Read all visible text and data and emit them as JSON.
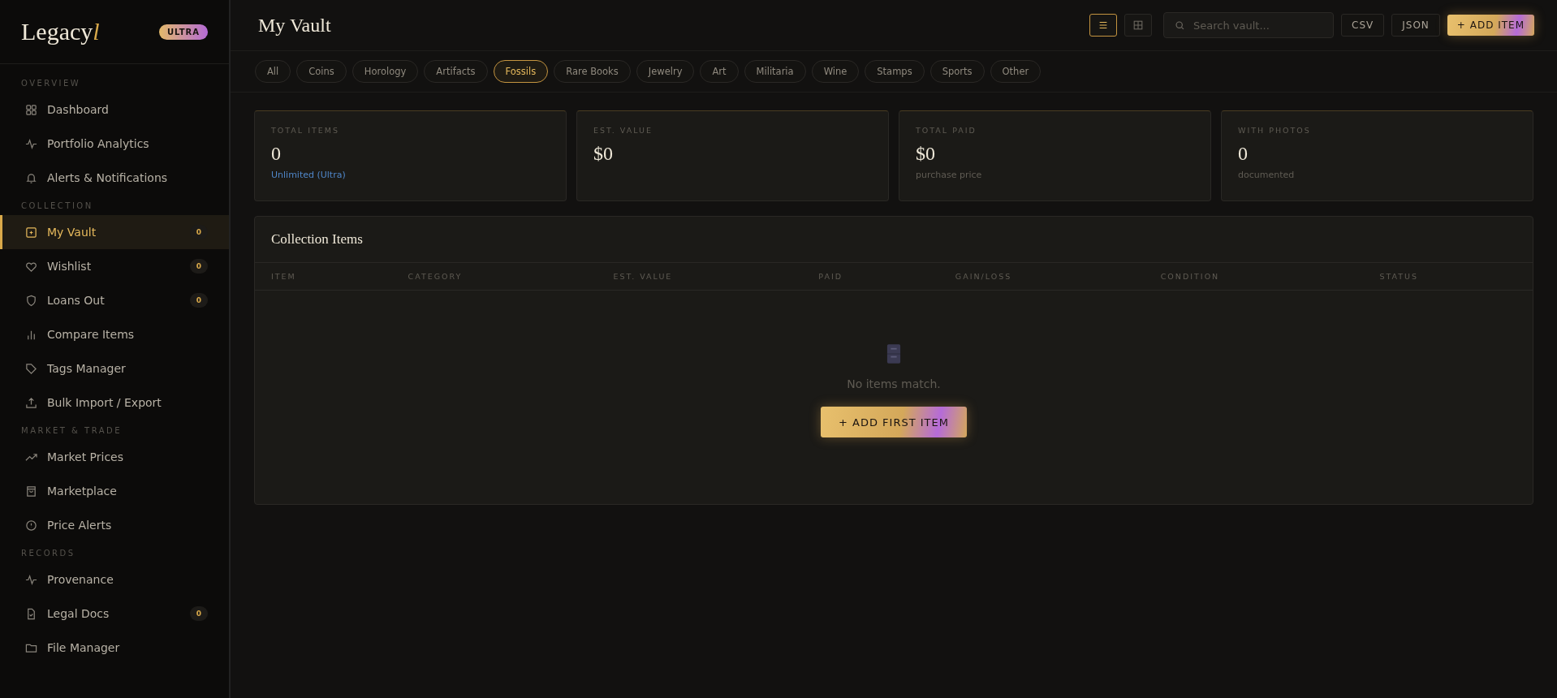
{
  "sidebar": {
    "logo": "Legacy",
    "logo_mark": "l",
    "plan_badge": "ULTRA",
    "sections": [
      {
        "title": "OVERVIEW",
        "items": [
          {
            "label": "Dashboard",
            "selected": false
          },
          {
            "label": "Portfolio Analytics",
            "selected": false
          },
          {
            "label": "Alerts & Notifications",
            "selected": false
          }
        ]
      },
      {
        "title": "COLLECTION",
        "items": [
          {
            "label": "My Vault",
            "selected": true,
            "count": "0"
          },
          {
            "label": "Wishlist",
            "selected": false,
            "count": "0"
          },
          {
            "label": "Loans Out",
            "selected": false,
            "count": "0"
          },
          {
            "label": "Compare Items",
            "selected": false
          },
          {
            "label": "Tags Manager",
            "selected": false
          },
          {
            "label": "Bulk Import / Export",
            "selected": false
          }
        ]
      },
      {
        "title": "MARKET & TRADE",
        "items": [
          {
            "label": "Market Prices",
            "selected": false
          },
          {
            "label": "Marketplace",
            "selected": false
          },
          {
            "label": "Price Alerts",
            "selected": false
          }
        ]
      },
      {
        "title": "RECORDS",
        "items": [
          {
            "label": "Provenance",
            "selected": false
          },
          {
            "label": "Legal Docs",
            "selected": false,
            "count": "0"
          },
          {
            "label": "File Manager",
            "selected": false
          }
        ]
      }
    ]
  },
  "header": {
    "title": "My Vault",
    "views": [
      {
        "kind": "list",
        "selected": true
      },
      {
        "kind": "grid",
        "selected": false
      }
    ],
    "search": {
      "placeholder": "Search vault..."
    },
    "export_buttons": [
      "CSV",
      "JSON"
    ],
    "add_button": "+ ADD ITEM"
  },
  "filters": [
    {
      "label": "All",
      "selected": false
    },
    {
      "label": "Coins",
      "selected": false
    },
    {
      "label": "Horology",
      "selected": false
    },
    {
      "label": "Artifacts",
      "selected": false
    },
    {
      "label": "Fossils",
      "selected": true
    },
    {
      "label": "Rare Books",
      "selected": false
    },
    {
      "label": "Jewelry",
      "selected": false
    },
    {
      "label": "Art",
      "selected": false
    },
    {
      "label": "Militaria",
      "selected": false
    },
    {
      "label": "Wine",
      "selected": false
    },
    {
      "label": "Stamps",
      "selected": false
    },
    {
      "label": "Sports",
      "selected": false
    },
    {
      "label": "Other",
      "selected": false
    }
  ],
  "stats": [
    {
      "label": "TOTAL ITEMS",
      "value": "0",
      "note": "Unlimited (Ultra)",
      "kind": "link"
    },
    {
      "label": "EST. VALUE",
      "value": "$0"
    },
    {
      "label": "TOTAL PAID",
      "value": "$0",
      "note": "purchase price",
      "kind": "muted"
    },
    {
      "label": "WITH PHOTOS",
      "value": "0",
      "note": "documented",
      "kind": "muted"
    }
  ],
  "table": {
    "title": "Collection Items",
    "columns": [
      "ITEM",
      "CATEGORY",
      "EST. VALUE",
      "PAID",
      "GAIN/LOSS",
      "CONDITION",
      "STATUS"
    ],
    "empty_message": "No items match.",
    "empty_button": "+ ADD FIRST ITEM"
  }
}
